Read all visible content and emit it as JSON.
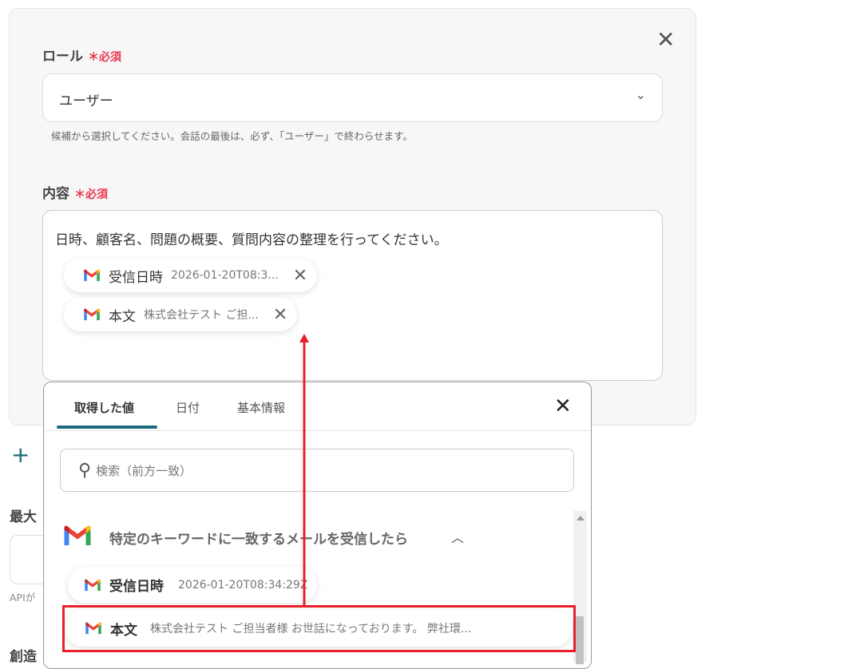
{
  "role": {
    "label": "ロール",
    "required": "必須",
    "value": "ユーザー",
    "help": "候補から選択してください。会話の最後は、必ず、「ユーザー」で終わらせます。"
  },
  "content": {
    "label": "内容",
    "required": "必須",
    "text": "日時、顧客名、問題の概要、質問内容の整理を行ってください。",
    "chips": [
      {
        "key": "受信日時",
        "value": "2026-01-20T08:3..."
      },
      {
        "key": "本文",
        "value": "株式会社テスト ご担..."
      }
    ]
  },
  "left": {
    "max_label": "最大",
    "api_help": "APIが",
    "create_label": "創造"
  },
  "picker": {
    "tabs": [
      "取得した値",
      "日付",
      "基本情報"
    ],
    "search_placeholder": "検索（前方一致）",
    "group": "特定のキーワードに一致するメールを受信したら",
    "items": [
      {
        "key": "受信日時",
        "value": "2026-01-20T08:34:29Z"
      },
      {
        "key": "本文",
        "value": "株式会社テスト ご担当者様 お世話になっております。 弊社環..."
      }
    ]
  },
  "colors": {
    "accent": "#1a6b7c",
    "required": "#e8384f",
    "highlight": "#e8202a"
  }
}
